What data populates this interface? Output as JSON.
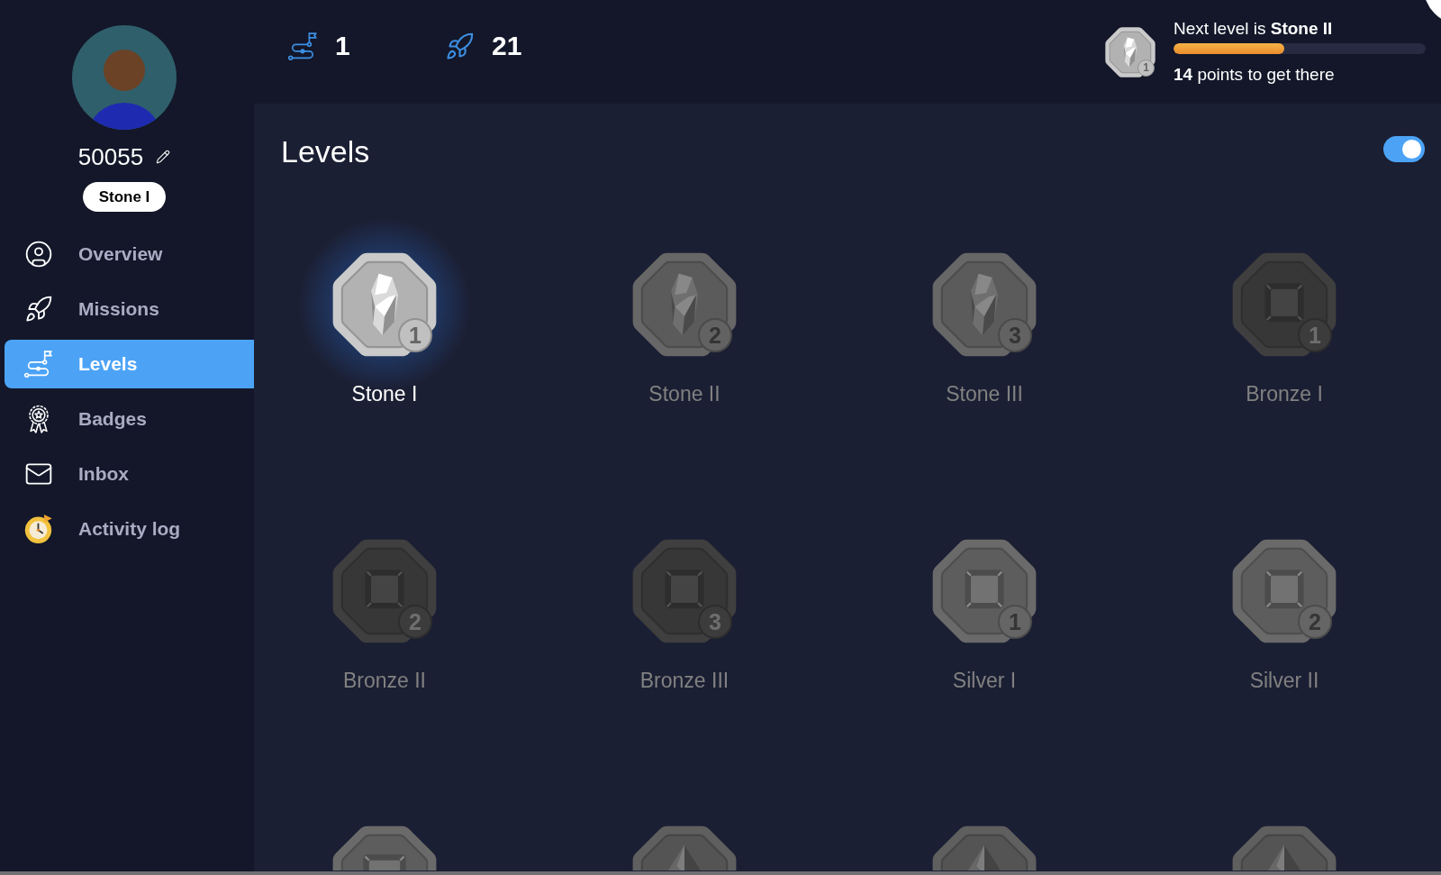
{
  "sidebar": {
    "username": "50055",
    "rank_badge": "Stone I",
    "items": [
      {
        "label": "Overview",
        "selected": false
      },
      {
        "label": "Missions",
        "selected": false
      },
      {
        "label": "Levels",
        "selected": true
      },
      {
        "label": "Badges",
        "selected": false
      },
      {
        "label": "Inbox",
        "selected": false
      },
      {
        "label": "Activity log",
        "selected": false
      }
    ]
  },
  "top_bar": {
    "stats": [
      {
        "value": "1"
      },
      {
        "value": "21"
      }
    ],
    "next_level": {
      "medal": {
        "kind": "crystal",
        "color": "#cacaca",
        "number": "1"
      },
      "text": "Next level is **Stone II**",
      "level": 0.44,
      "points": "**14** points to get there"
    }
  },
  "page": {
    "title": "Levels",
    "toggle": {
      "on": true
    }
  },
  "levels": [
    {
      "name": "Stone I",
      "number": "1",
      "kind": "crystal",
      "color": "#cacaca",
      "current": true
    },
    {
      "name": "Stone II",
      "number": "2",
      "kind": "crystal",
      "color": "#676767",
      "current": false
    },
    {
      "name": "Stone III",
      "number": "3",
      "kind": "crystal",
      "color": "#676767",
      "current": false
    },
    {
      "name": "Bronze I",
      "number": "1",
      "kind": "square",
      "color": "#3f3f3f",
      "current": false
    },
    {
      "name": "Bronze II",
      "number": "2",
      "kind": "square",
      "color": "#3f3f3f",
      "current": false
    },
    {
      "name": "Bronze III",
      "number": "3",
      "kind": "square",
      "color": "#3f3f3f",
      "current": false
    },
    {
      "name": "Silver I",
      "number": "1",
      "kind": "square",
      "color": "#6a6a6a",
      "current": false
    },
    {
      "name": "Silver II",
      "number": "2",
      "kind": "square",
      "color": "#6a6a6a",
      "current": false
    }
  ],
  "levels_cut_off": [
    {
      "kind": "emerald",
      "color": "#6a6a6a"
    },
    {
      "kind": "pyramid",
      "color": "#5f5f5f"
    },
    {
      "kind": "pyramid",
      "color": "#5f5f5f"
    },
    {
      "kind": "pyramid",
      "color": "#5f5f5f"
    }
  ]
}
